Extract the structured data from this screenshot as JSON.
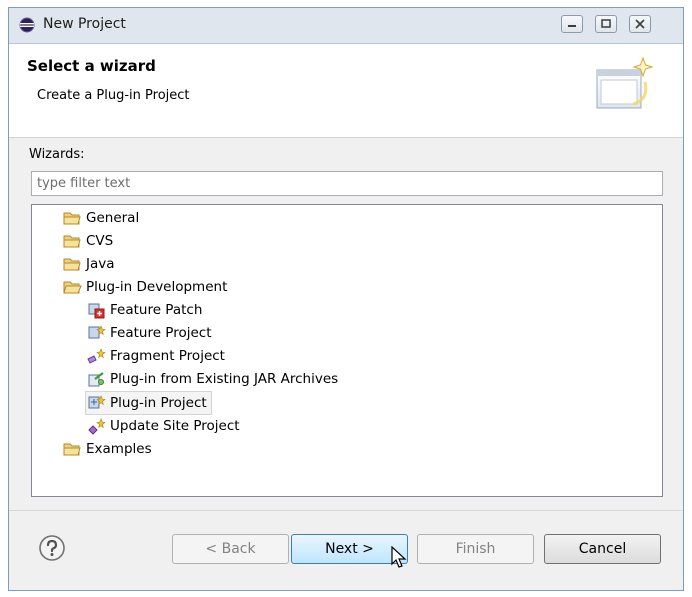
{
  "window": {
    "title": "New Project"
  },
  "header": {
    "title": "Select a wizard",
    "description": "Create a Plug-in Project"
  },
  "wizards_label": "Wizards:",
  "filter": {
    "placeholder": "type filter text",
    "value": ""
  },
  "tree": {
    "items": [
      {
        "label": "General",
        "icon": "folder-icon",
        "level": 0,
        "expanded": false
      },
      {
        "label": "CVS",
        "icon": "folder-icon",
        "level": 0,
        "expanded": false
      },
      {
        "label": "Java",
        "icon": "folder-icon",
        "level": 0,
        "expanded": false
      },
      {
        "label": "Plug-in Development",
        "icon": "folder-open-icon",
        "level": 0,
        "expanded": true
      },
      {
        "label": "Feature Patch",
        "icon": "feature-patch-icon",
        "level": 1
      },
      {
        "label": "Feature Project",
        "icon": "feature-project-icon",
        "level": 1
      },
      {
        "label": "Fragment Project",
        "icon": "fragment-project-icon",
        "level": 1
      },
      {
        "label": "Plug-in from Existing JAR Archives",
        "icon": "jar-plugin-icon",
        "level": 1
      },
      {
        "label": "Plug-in Project",
        "icon": "plugin-project-icon",
        "level": 1,
        "selected": true
      },
      {
        "label": "Update Site Project",
        "icon": "update-site-icon",
        "level": 1
      },
      {
        "label": "Examples",
        "icon": "folder-icon",
        "level": 0,
        "expanded": false
      }
    ]
  },
  "buttons": {
    "back": "< Back",
    "next": "Next >",
    "finish": "Finish",
    "cancel": "Cancel"
  },
  "help_icon": "help-icon",
  "colors": {
    "accent": "#3c7fb1",
    "selection_bg": "#f4f4f4",
    "folder": "#e8c15a"
  }
}
